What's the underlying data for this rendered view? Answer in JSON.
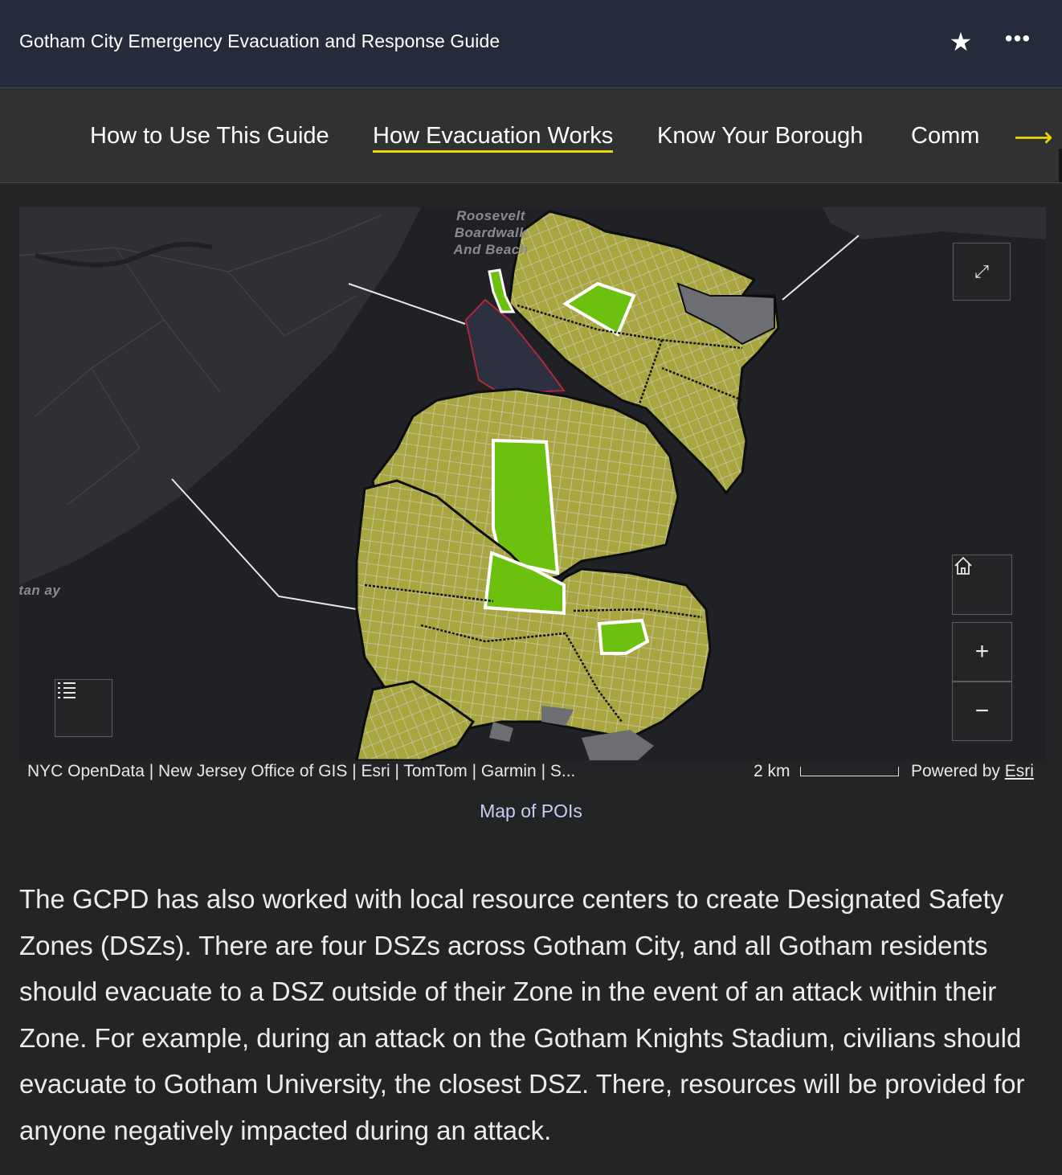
{
  "header": {
    "title": "Gotham City Emergency Evacuation and Response Guide",
    "favorite_icon": "star-icon",
    "more_icon": "more-options-icon"
  },
  "nav": {
    "tabs": [
      {
        "label": "How to Use This Guide",
        "active": false
      },
      {
        "label": "How Evacuation Works",
        "active": true
      },
      {
        "label": "Know Your Borough",
        "active": false
      },
      {
        "label": "Comm",
        "active": false
      }
    ],
    "next_icon": "arrow-right-icon",
    "accent_color": "#f0d400"
  },
  "map": {
    "poi_label": "Roosevelt Boardwalk And Beach",
    "water_label": "itan ay",
    "controls": {
      "fullscreen_icon": "expand-icon",
      "home_icon": "home-icon",
      "zoom_in": "+",
      "zoom_out": "−",
      "legend_icon": "legend-list-icon"
    },
    "colors": {
      "land_zone": "#b7b34a",
      "park": "#6cc10f",
      "water": "#1f2125",
      "restricted": "#2d3040"
    }
  },
  "attribution": {
    "sources": "NYC OpenData | New Jersey Office of GIS | Esri | TomTom | Garmin | S...",
    "scale": "2 km",
    "powered_prefix": "Powered by ",
    "powered_link": "Esri"
  },
  "caption": "Map of POIs",
  "body": {
    "paragraph": "The GCPD has also worked with local resource centers to create Designated Safety Zones (DSZs). There are four DSZs across Gotham City, and all Gotham residents should evacuate to a DSZ outside of their Zone in the event of an attack within their Zone. For example, during an attack on the Gotham Knights Stadium, civilians should evacuate to Gotham University, the closest DSZ. There, resources will be provided for anyone negatively impacted during an attack."
  }
}
